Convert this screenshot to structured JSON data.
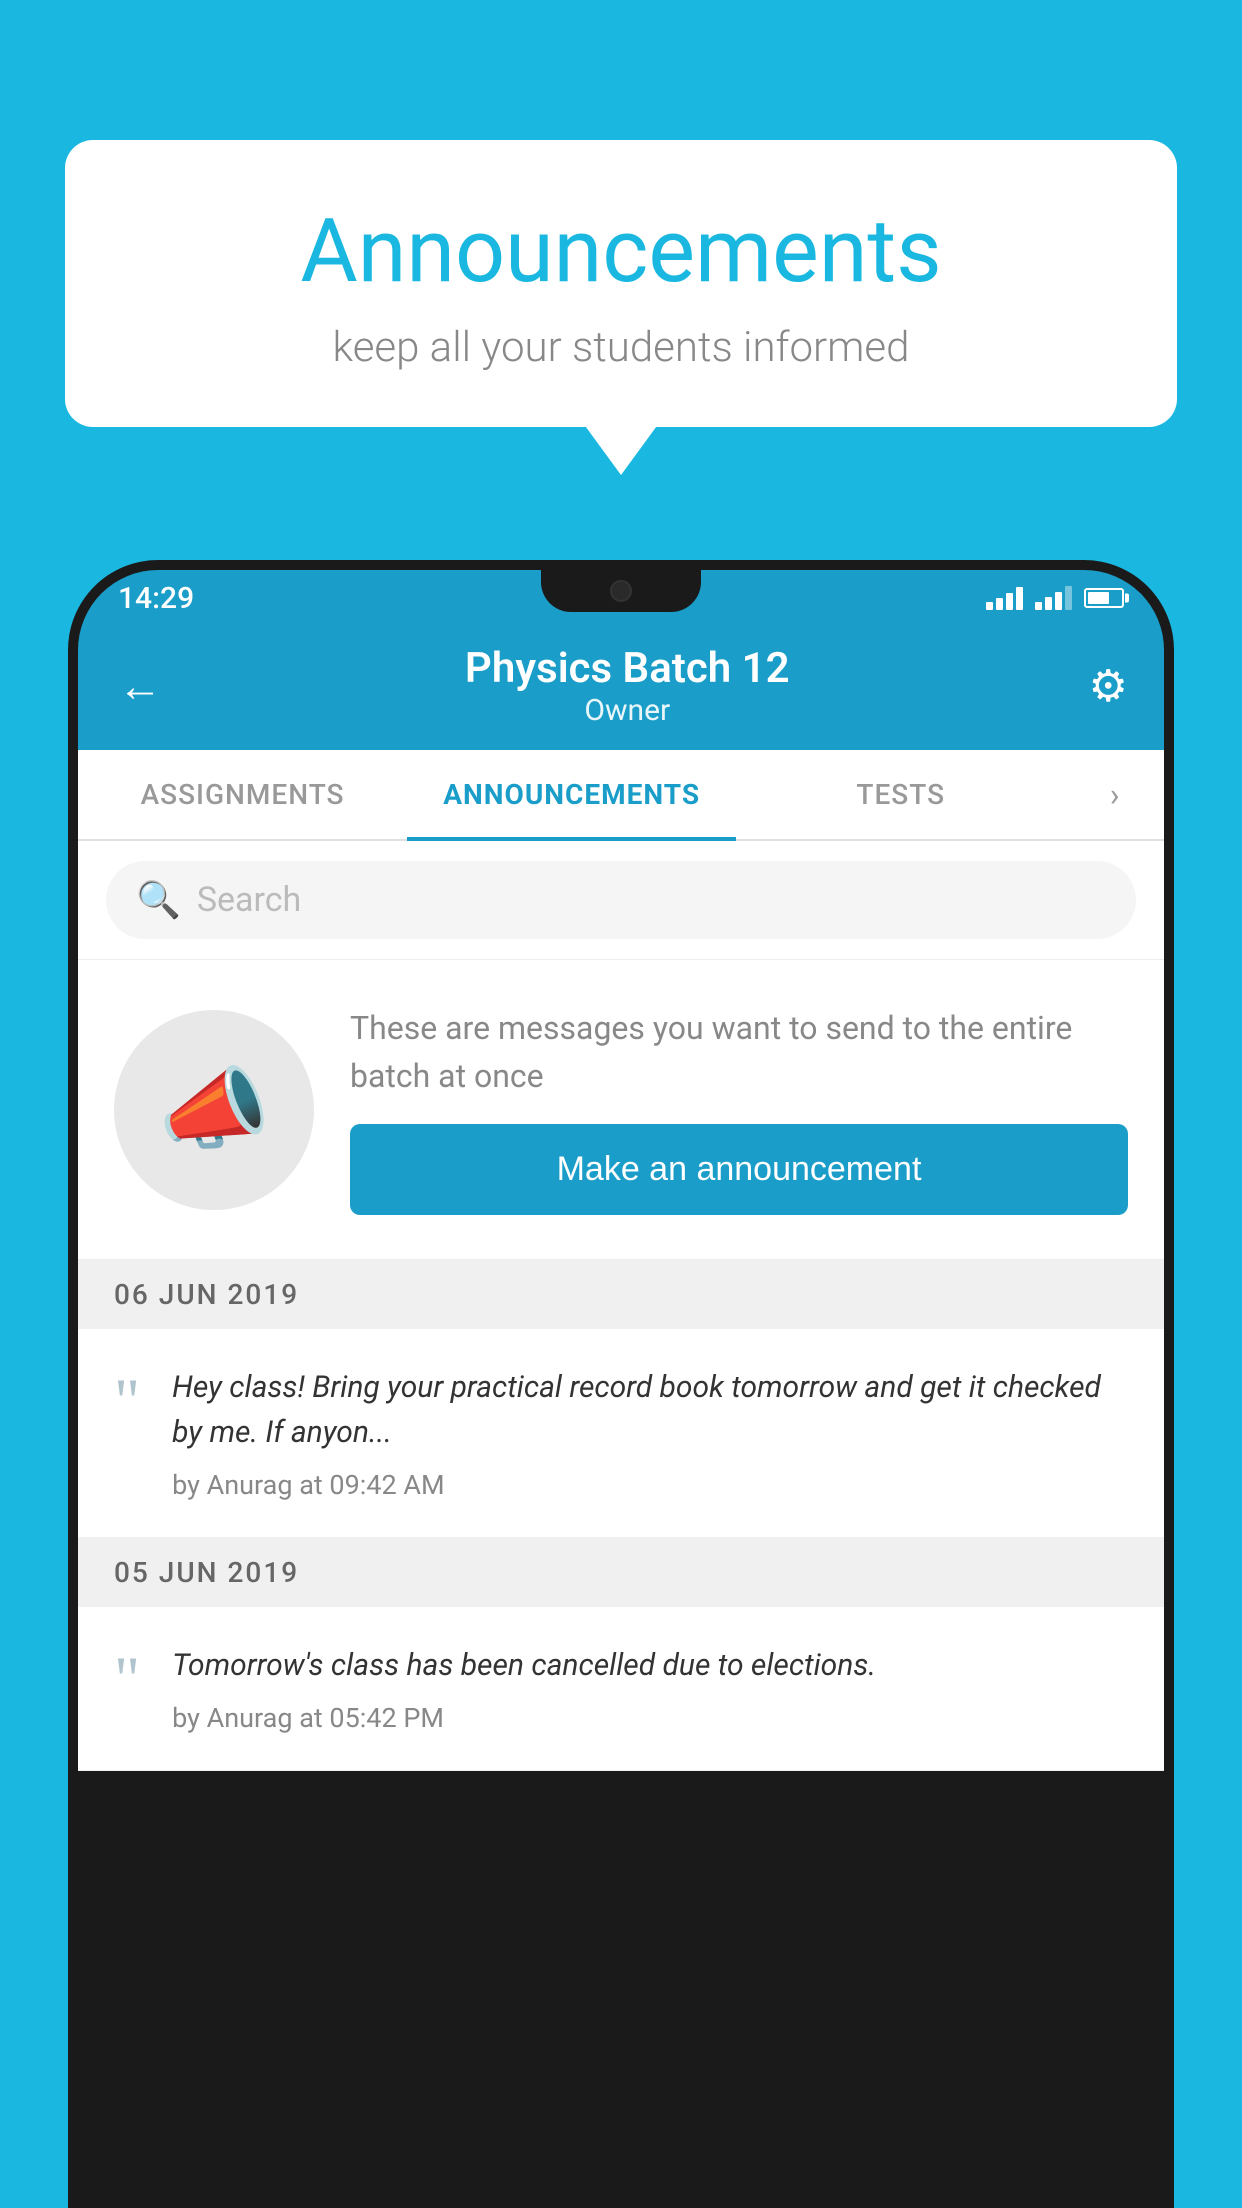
{
  "background_color": "#1ab8e0",
  "speech_bubble": {
    "title": "Announcements",
    "subtitle": "keep all your students informed"
  },
  "phone": {
    "status_bar": {
      "time": "14:29"
    },
    "header": {
      "title": "Physics Batch 12",
      "subtitle": "Owner",
      "back_label": "←",
      "gear_label": "⚙"
    },
    "tabs": [
      {
        "label": "ASSIGNMENTS",
        "active": false
      },
      {
        "label": "ANNOUNCEMENTS",
        "active": true
      },
      {
        "label": "TESTS",
        "active": false
      }
    ],
    "search": {
      "placeholder": "Search"
    },
    "empty_state": {
      "description": "These are messages you want to send to the entire batch at once",
      "button_label": "Make an announcement"
    },
    "announcements": [
      {
        "date": "06  JUN  2019",
        "text": "Hey class! Bring your practical record book tomorrow and get it checked by me. If anyon...",
        "meta": "by Anurag at 09:42 AM"
      },
      {
        "date": "05  JUN  2019",
        "text": "Tomorrow's class has been cancelled due to elections.",
        "meta": "by Anurag at 05:42 PM"
      }
    ]
  }
}
